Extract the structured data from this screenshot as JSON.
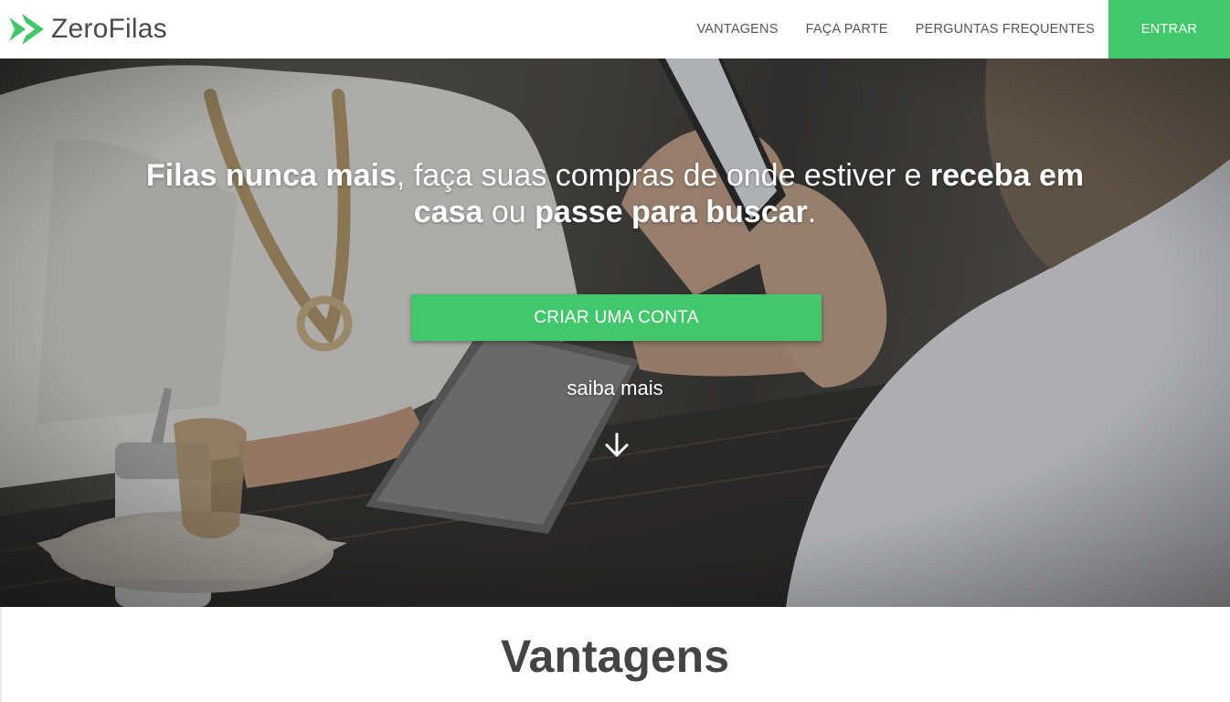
{
  "brand": {
    "name": "ZeroFilas",
    "logo_icon": "double-arrow-icon",
    "accent": "#43c76c"
  },
  "nav": {
    "links": [
      "VANTAGENS",
      "FAÇA PARTE",
      "PERGUNTAS FREQUENTES"
    ],
    "login_label": "ENTRAR"
  },
  "hero": {
    "headline_parts": {
      "p1": "Filas nunca mais",
      "p2": ", faça suas compras de onde estiver e ",
      "p3": "receba em casa",
      "p4": " ou ",
      "p5": "passe para buscar",
      "p6": "."
    },
    "cta_label": "CRIAR UMA CONTA",
    "learn_more": "saiba mais",
    "learn_more_icon": "arrow-down-icon"
  },
  "section": {
    "title": "Vantagens"
  }
}
